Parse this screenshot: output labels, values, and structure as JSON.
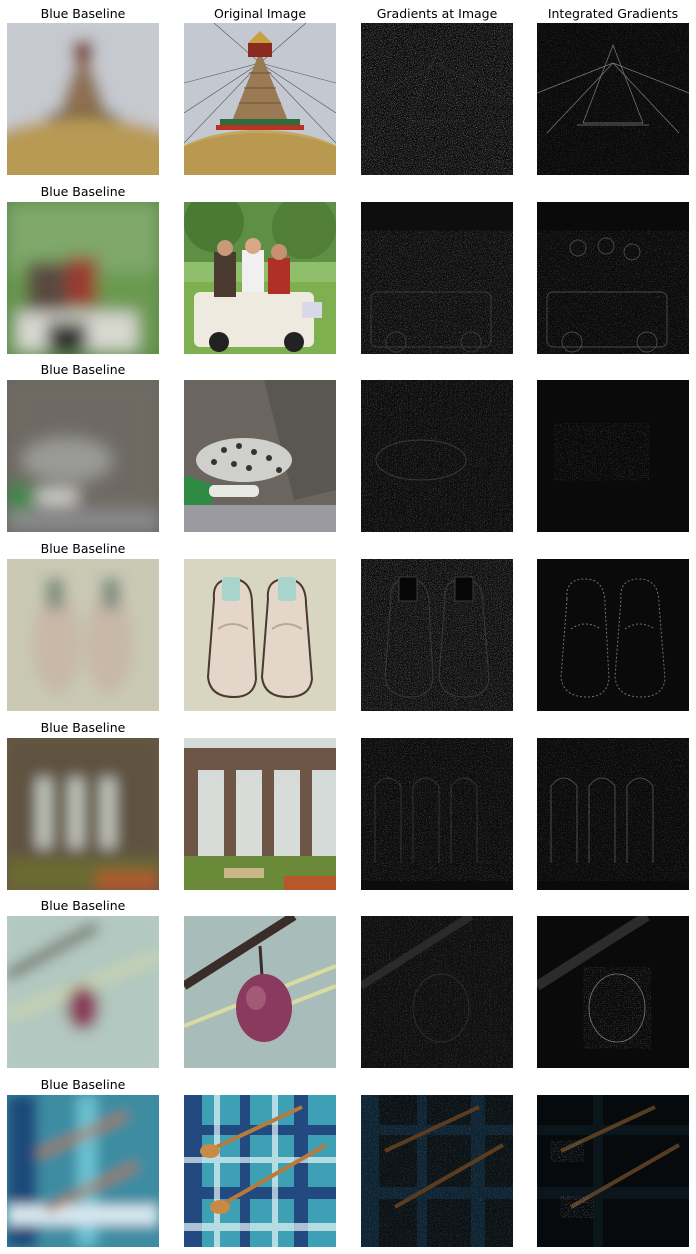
{
  "headers": {
    "blue_baseline": "Blue Baseline",
    "original_image": "Original Image",
    "gradients_at_image": "Gradients at Image",
    "integrated_gradients": "Integrated Gradients"
  },
  "rows": [
    {
      "subject": "stupa with prayer flags",
      "row_title": "Blue Baseline"
    },
    {
      "subject": "people in golf cart",
      "row_title": "Blue Baseline"
    },
    {
      "subject": "snow leopard",
      "row_title": "Blue Baseline"
    },
    {
      "subject": "pair of loafers",
      "row_title": "Blue Baseline"
    },
    {
      "subject": "stone viaduct arches",
      "row_title": "Blue Baseline"
    },
    {
      "subject": "plum on branch",
      "row_title": "Blue Baseline"
    },
    {
      "subject": "wooden spoons on plaid cloth",
      "row_title": "Blue Baseline"
    }
  ],
  "colors": {
    "background": "#ffffff",
    "attribution_background": "#0b0b0b"
  }
}
